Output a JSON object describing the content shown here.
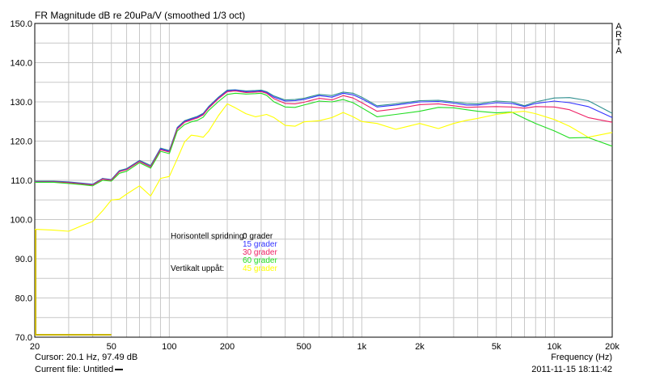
{
  "chart_data": {
    "type": "line",
    "title": "FR Magnitude dB re 20uPa/V (smoothed 1/3 oct)",
    "x_scale": "log",
    "xlim": [
      20,
      20000
    ],
    "ylim": [
      70,
      150
    ],
    "grid": true,
    "y_ticks": [
      "70.0",
      "80.0",
      "90.0",
      "100.0",
      "110.0",
      "120.0",
      "130.0",
      "140.0",
      "150.0"
    ],
    "x_ticks": [
      {
        "value": 20,
        "label": "20"
      },
      {
        "value": 50,
        "label": "50"
      },
      {
        "value": 100,
        "label": "100"
      },
      {
        "value": 200,
        "label": "200"
      },
      {
        "value": 500,
        "label": "500"
      },
      {
        "value": 1000,
        "label": "1k"
      },
      {
        "value": 2000,
        "label": "2k"
      },
      {
        "value": 5000,
        "label": "5k"
      },
      {
        "value": 10000,
        "label": "10k"
      },
      {
        "value": 20000,
        "label": "20k"
      }
    ],
    "xlabel": "Frequency (Hz)",
    "legend": {
      "placement": "center-left",
      "rows": [
        {
          "label": "Horisontell spridning:",
          "text": "0 grader",
          "color": "#000000"
        },
        {
          "label": "",
          "text": "15 grader",
          "color": "#3333ff"
        },
        {
          "label": "",
          "text": "30 grader",
          "color": "#ee2266"
        },
        {
          "label": "",
          "text": "60 grader",
          "color": "#22dd22"
        },
        {
          "label": "Vertikalt uppåt:",
          "text": "45 grader",
          "color": "#ffff00"
        }
      ]
    },
    "series": [
      {
        "text": "0 grader",
        "color": "#2f8f8f",
        "x": [
          20,
          25,
          30,
          35,
          40,
          45,
          50,
          55,
          60,
          70,
          80,
          90,
          100,
          110,
          120,
          130,
          140,
          150,
          160,
          180,
          200,
          220,
          250,
          280,
          300,
          320,
          350,
          400,
          450,
          500,
          600,
          700,
          800,
          900,
          1000,
          1200,
          1500,
          2000,
          2500,
          3000,
          3500,
          4000,
          5000,
          6000,
          7000,
          8000,
          10000,
          12000,
          15000,
          20000
        ],
        "y": [
          109.8,
          109.8,
          109.6,
          109.3,
          109.0,
          110.5,
          110.2,
          112.5,
          113.0,
          115.1,
          113.8,
          118.2,
          117.6,
          123.5,
          125.2,
          125.8,
          126.3,
          127.1,
          128.8,
          131.2,
          133.0,
          133.1,
          132.8,
          132.9,
          133.0,
          132.6,
          131.5,
          130.5,
          130.6,
          130.9,
          131.9,
          131.6,
          132.5,
          132.2,
          131.2,
          129.0,
          129.5,
          130.3,
          130.4,
          130.0,
          129.6,
          129.5,
          130.2,
          130.0,
          129.0,
          130.0,
          131.0,
          131.1,
          130.3,
          127.1
        ]
      },
      {
        "text": "15 grader",
        "color": "#3333ff",
        "x": [
          20,
          25,
          30,
          35,
          40,
          45,
          50,
          55,
          60,
          70,
          80,
          90,
          100,
          110,
          120,
          130,
          140,
          150,
          160,
          180,
          200,
          220,
          250,
          280,
          300,
          320,
          350,
          400,
          450,
          500,
          600,
          700,
          800,
          900,
          1000,
          1200,
          1500,
          2000,
          2500,
          3000,
          3500,
          4000,
          5000,
          6000,
          7000,
          8000,
          10000,
          12000,
          15000,
          20000
        ],
        "y": [
          109.7,
          109.7,
          109.5,
          109.2,
          108.9,
          110.4,
          110.1,
          112.3,
          112.8,
          114.9,
          113.5,
          118.0,
          117.4,
          123.3,
          125.0,
          125.6,
          126.1,
          126.9,
          128.6,
          131.0,
          132.8,
          133.0,
          132.6,
          132.7,
          132.8,
          132.4,
          131.2,
          130.2,
          130.3,
          130.6,
          131.6,
          131.2,
          132.2,
          131.8,
          130.8,
          128.7,
          129.2,
          130.0,
          130.1,
          129.7,
          129.2,
          129.2,
          129.8,
          129.6,
          128.8,
          129.6,
          130.2,
          129.8,
          128.8,
          126.0
        ]
      },
      {
        "text": "30 grader",
        "color": "#ee2266",
        "x": [
          20,
          25,
          30,
          35,
          40,
          45,
          50,
          55,
          60,
          70,
          80,
          90,
          100,
          110,
          120,
          130,
          140,
          150,
          160,
          180,
          200,
          220,
          250,
          280,
          300,
          320,
          350,
          400,
          450,
          500,
          600,
          700,
          800,
          900,
          1000,
          1200,
          1500,
          2000,
          2500,
          3000,
          3500,
          4000,
          5000,
          6000,
          7000,
          8000,
          10000,
          12000,
          15000,
          20000
        ],
        "y": [
          109.6,
          109.6,
          109.4,
          109.1,
          108.8,
          110.3,
          110.0,
          112.2,
          112.7,
          114.8,
          113.4,
          117.8,
          117.2,
          123.1,
          124.8,
          125.4,
          125.9,
          126.7,
          128.4,
          130.8,
          132.6,
          132.8,
          132.4,
          132.5,
          132.6,
          132.2,
          130.8,
          129.6,
          129.5,
          129.9,
          130.9,
          130.5,
          131.6,
          131.0,
          129.8,
          127.6,
          128.2,
          129.3,
          129.5,
          129.0,
          128.6,
          128.7,
          128.8,
          128.7,
          128.4,
          128.8,
          128.7,
          128.0,
          126.0,
          124.8
        ]
      },
      {
        "text": "60 grader",
        "color": "#22dd22",
        "x": [
          20,
          25,
          30,
          35,
          40,
          45,
          50,
          55,
          60,
          70,
          80,
          90,
          100,
          110,
          120,
          130,
          140,
          150,
          160,
          180,
          200,
          220,
          250,
          280,
          300,
          320,
          350,
          400,
          450,
          500,
          600,
          700,
          800,
          900,
          1000,
          1200,
          1500,
          2000,
          2500,
          3000,
          3500,
          4000,
          5000,
          6000,
          7000,
          8000,
          10000,
          12000,
          15000,
          20000
        ],
        "y": [
          109.5,
          109.5,
          109.2,
          108.9,
          108.6,
          110.0,
          109.8,
          111.8,
          112.3,
          114.5,
          113.1,
          117.4,
          116.8,
          122.6,
          124.2,
          124.9,
          125.3,
          126.1,
          127.8,
          130.1,
          131.9,
          132.2,
          132.0,
          132.1,
          132.2,
          131.7,
          130.0,
          128.7,
          128.6,
          129.2,
          130.2,
          130.0,
          130.6,
          129.8,
          128.5,
          126.2,
          126.8,
          127.6,
          128.6,
          128.5,
          128.0,
          127.6,
          127.2,
          127.4,
          125.8,
          124.5,
          122.6,
          120.8,
          120.9,
          118.7
        ]
      },
      {
        "text": "45 grader",
        "color": "#ffff00",
        "x": [
          20,
          25,
          30,
          35,
          40,
          45,
          50,
          55,
          60,
          70,
          80,
          90,
          100,
          110,
          120,
          130,
          140,
          150,
          160,
          180,
          200,
          220,
          250,
          280,
          300,
          320,
          350,
          400,
          450,
          500,
          600,
          700,
          800,
          900,
          1000,
          1200,
          1500,
          2000,
          2500,
          3000,
          3500,
          4000,
          5000,
          6000,
          7000,
          8000,
          10000,
          12000,
          15000,
          20000
        ],
        "y": [
          97.5,
          97.3,
          97.0,
          98.4,
          99.5,
          102.2,
          105.0,
          105.2,
          106.5,
          108.6,
          106.0,
          110.5,
          111.0,
          115.5,
          119.8,
          121.5,
          121.3,
          121.0,
          122.5,
          126.5,
          129.5,
          128.5,
          127.0,
          126.2,
          126.5,
          126.8,
          126.0,
          124.0,
          123.8,
          124.9,
          125.2,
          126.0,
          127.3,
          126.2,
          125.0,
          124.5,
          123.0,
          124.5,
          123.2,
          124.5,
          125.3,
          125.8,
          126.8,
          127.3,
          127.6,
          127.0,
          125.5,
          123.8,
          121.0,
          122.2
        ]
      }
    ]
  },
  "header": {
    "title": "FR Magnitude dB re 20uPa/V (smoothed 1/3 oct)",
    "brand": [
      "A",
      "R",
      "T",
      "A"
    ]
  },
  "status": {
    "cursor": "Cursor: 20.1 Hz, 97.49 dB",
    "current_file": "Current file: Untitled",
    "frequency_label": "Frequency (Hz)",
    "datetime": "2011-11-15  18:11:42"
  },
  "colors": {
    "grid": "#c8c8c8",
    "frame": "#000000",
    "marker": "#c8b400"
  }
}
